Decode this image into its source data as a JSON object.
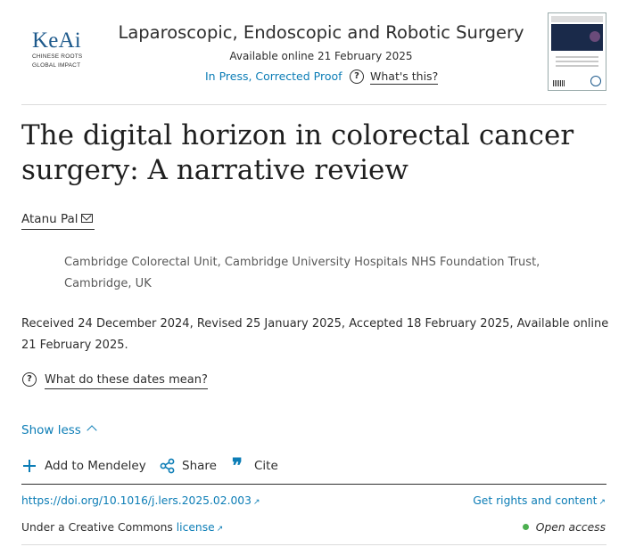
{
  "header": {
    "logo_text": "KeAi",
    "logo_tagline_1": "CHINESE ROOTS",
    "logo_tagline_2": "GLOBAL IMPACT",
    "journal_title": "Laparoscopic, Endoscopic and Robotic Surgery",
    "available_online": "Available online 21 February 2025",
    "status_link": "In Press, Corrected Proof",
    "whats_this": "What's this?"
  },
  "article": {
    "title": "The digital horizon in colorectal cancer surgery: A narrative review",
    "author": "Atanu Pal",
    "affiliation": "Cambridge Colorectal Unit, Cambridge University Hospitals NHS Foundation Trust, Cambridge, UK",
    "dates": "Received 24 December 2024, Revised 25 January 2025, Accepted 18 February 2025, Available online 21 February 2025.",
    "dates_help": "What do these dates mean?",
    "show_less": "Show less"
  },
  "actions": {
    "mendeley": "Add to Mendeley",
    "share": "Share",
    "cite": "Cite"
  },
  "links": {
    "doi": "https://doi.org/10.1016/j.lers.2025.02.003",
    "rights": "Get rights and content",
    "cc_prefix": "Under a Creative Commons",
    "cc_link": "license",
    "open_access": "Open access"
  },
  "colors": {
    "link": "#0c7db6",
    "open_access_dot": "#4caf50"
  }
}
